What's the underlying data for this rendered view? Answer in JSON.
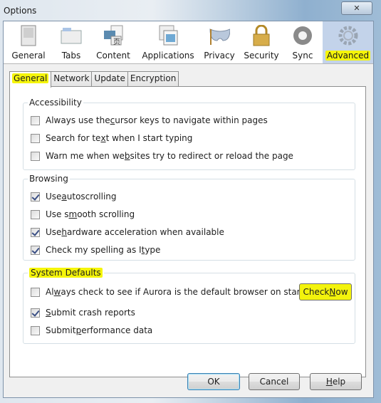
{
  "window": {
    "title": "Options",
    "close_icon": "close-icon"
  },
  "toolbar": {
    "items": [
      {
        "label": "General",
        "icon": "switch-icon"
      },
      {
        "label": "Tabs",
        "icon": "folder-tab-icon"
      },
      {
        "label": "Content",
        "icon": "content-icon"
      },
      {
        "label": "Applications",
        "icon": "applications-icon"
      },
      {
        "label": "Privacy",
        "icon": "mask-icon"
      },
      {
        "label": "Security",
        "icon": "padlock-icon"
      },
      {
        "label": "Sync",
        "icon": "sync-icon"
      },
      {
        "label": "Advanced",
        "icon": "gear-icon",
        "selected": true
      }
    ]
  },
  "tabs": [
    {
      "label": "General",
      "active": true
    },
    {
      "label": "Network"
    },
    {
      "label": "Update"
    },
    {
      "label": "Encryption"
    }
  ],
  "groups": {
    "accessibility": {
      "title": "Accessibility",
      "items": [
        {
          "pre": "Always use the ",
          "u": "c",
          "post": "ursor keys to navigate within pages",
          "checked": false
        },
        {
          "pre": "Search for te",
          "u": "x",
          "post": "t when I start typing",
          "checked": false
        },
        {
          "pre": "Warn me when we",
          "u": "b",
          "post": " sites try to redirect or reload the page",
          "checked": false
        }
      ]
    },
    "browsing": {
      "title": "Browsing",
      "items": [
        {
          "pre": "Use ",
          "u": "a",
          "post": "utoscrolling",
          "checked": true
        },
        {
          "pre": "Use s",
          "u": "m",
          "post": "ooth scrolling",
          "checked": false
        },
        {
          "pre": "Use ",
          "u": "h",
          "post": "ardware acceleration when available",
          "checked": true
        },
        {
          "pre": "Check my spelling as I ",
          "u": "t",
          "post": "ype",
          "checked": true
        }
      ]
    },
    "system": {
      "title": "System Defaults",
      "items": [
        {
          "pre": "Al",
          "u": "w",
          "post": "ays check to see if Aurora is the default browser on startup",
          "checked": false
        },
        {
          "pre": "",
          "u": "S",
          "post": "ubmit crash reports",
          "checked": true
        },
        {
          "pre": "Submit ",
          "u": "p",
          "post": "erformance data",
          "checked": false
        }
      ],
      "check_now": {
        "pre": "Check ",
        "u": "N",
        "post": "ow"
      }
    }
  },
  "buttons": {
    "ok": "OK",
    "cancel": "Cancel",
    "help_u": "H",
    "help_rest": "elp"
  }
}
